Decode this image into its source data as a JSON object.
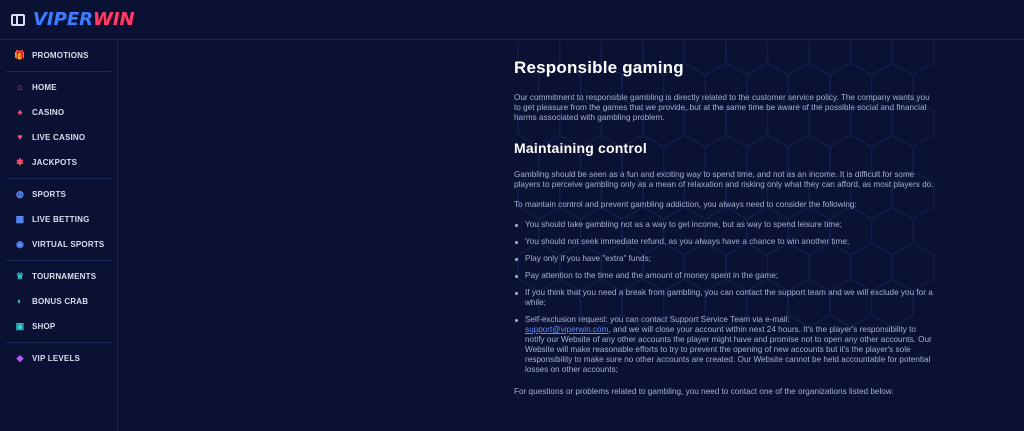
{
  "header": {
    "logo_part1": "VIPER",
    "logo_part2": "WIN",
    "toggle_icon": "sidebar-toggle-icon"
  },
  "colors": {
    "background": "#0a1133",
    "accent_blue": "#3d7bff",
    "accent_red": "#ff3b6b",
    "link": "#5d8dff"
  },
  "sidebar": {
    "groups": [
      [
        {
          "label": "PROMOTIONS",
          "icon": "gift-icon",
          "glyph": "🎁",
          "color": "#3fc28a"
        }
      ],
      [
        {
          "label": "HOME",
          "icon": "home-icon",
          "glyph": "⌂",
          "color": "#ff4f6e"
        },
        {
          "label": "CASINO",
          "icon": "casino-icon",
          "glyph": "♠",
          "color": "#ff4f6e"
        },
        {
          "label": "LIVE CASINO",
          "icon": "live-casino-icon",
          "glyph": "♥",
          "color": "#ff4f6e"
        },
        {
          "label": "JACKPOTS",
          "icon": "jackpots-icon",
          "glyph": "✱",
          "color": "#ff4f6e"
        }
      ],
      [
        {
          "label": "SPORTS",
          "icon": "sports-ball-icon",
          "glyph": "◍",
          "color": "#5d8dff"
        },
        {
          "label": "LIVE BETTING",
          "icon": "live-betting-icon",
          "glyph": "▦",
          "color": "#5d8dff"
        },
        {
          "label": "VIRTUAL SPORTS",
          "icon": "gamepad-icon",
          "glyph": "◉",
          "color": "#5d8dff"
        }
      ],
      [
        {
          "label": "TOURNAMENTS",
          "icon": "trophy-icon",
          "glyph": "♕",
          "color": "#36c9d6"
        },
        {
          "label": "BONUS CRAB",
          "icon": "crab-icon",
          "glyph": "◐",
          "color": "#36c9d6"
        },
        {
          "label": "SHOP",
          "icon": "shop-bag-icon",
          "glyph": "▣",
          "color": "#36c9d6"
        }
      ],
      [
        {
          "label": "VIP LEVELS",
          "icon": "diamond-icon",
          "glyph": "◆",
          "color": "#b65cff"
        }
      ]
    ]
  },
  "main": {
    "title": "Responsible gaming",
    "intro": "Our commitment to responsible gambling is directly related to the customer service policy. The company wants you to get pleasure from the games that we provide, but at the same time be aware of the possible social and financial harms associated with gambling problem.",
    "section_title": "Maintaining control",
    "para1": "Gambling should be seen as a fun and exciting way to spend time, and not as an income. It is difficult for some players to perceive gambling only as a mean of relaxation and risking only what they can afford, as most players do.",
    "para2": "To maintain control and prevent gambling addiction, you always need to consider the following:",
    "bullets": [
      "You should take gambling not as a way to get income, but as way to spend leisure time;",
      "You should not seek immediate refund, as you always have a chance to win another time;",
      "Play only if you have \"extra\" funds;",
      "Pay attention to the time and the amount of money spent in the game;",
      "If you think that you need a break from gambling, you can contact the support team and we will exclude you for a while;"
    ],
    "self_exclusion_prefix": "Self-exclusion request: you can contact Support Service Team via e-mail:",
    "email": "support@viperwin.com",
    "self_exclusion_suffix": ", and we will close your account within next 24 hours. It's the player's responsibility to notify our Website of any other accounts the player might have and promise not to open any other accounts. Our Website will make reasonable efforts to try to prevent the opening of new accounts but it's the player's sole responsibility to make sure no other accounts are created. Our Website cannot be held accountable for potential losses on other accounts;",
    "para3": "For questions or problems related to gambling, you need to contact one of the organizations listed below."
  }
}
